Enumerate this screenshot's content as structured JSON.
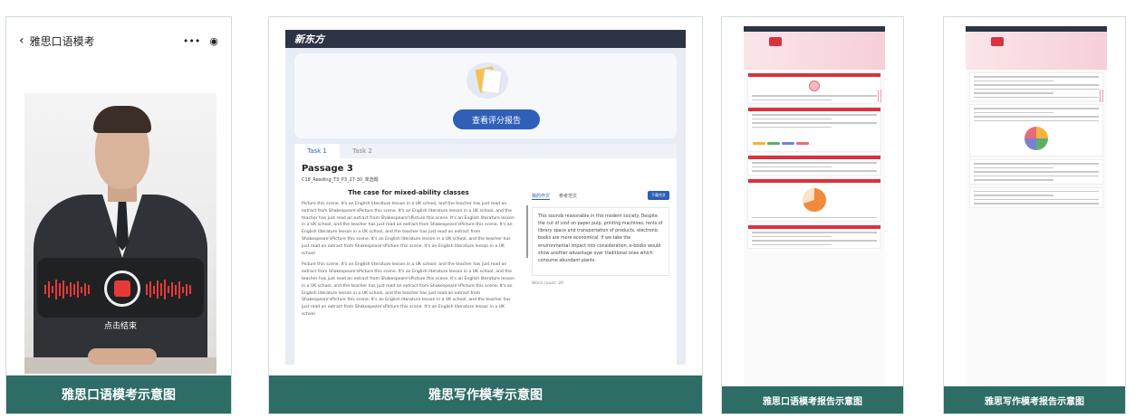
{
  "speaking_mock": {
    "nav_title": "雅思口语模考",
    "back_icon": "chevron-left-icon",
    "more_glyph": "•••",
    "record_label": "点击结束",
    "caption": "雅思口语模考示意图"
  },
  "writing_mock": {
    "logo": "新东方",
    "report_button": "查看评分报告",
    "tabs": [
      "Task 1",
      "Task 2"
    ],
    "active_tab": "Task 1",
    "passage_title": "Passage 3",
    "passage_subtitle": "C18_Reading_T3_P3_27-30_单选题",
    "article_title": "The case for mixed-ability classes",
    "paragraph_1": "Picture this scene. It's an English literature lesson in a UK school, and the teacher has just read an extract from Shakespeare'sPicture this scene. It's an English literature lesson in a UK school, and the teacher has just read an extract from Shakespeare'sPicture this scene. It's an English literature lesson in a UK school, and the teacher has just read an extract from Shakespeare'sPicture this scene. It's an English literature lesson in a UK school, and the teacher has just read an extract from Shakespeare'sPicture this scene. It's an English literature lesson in a UK school, and the teacher has just read an extract from Shakespeare'sPicture this scene. It's an English literature lesson in a UK school",
    "paragraph_2": "Picture this scene. It's an English literature lesson in a UK school, and the teacher has just read an extract from Shakespeare'sPicture this scene. It's an English literature lesson in a UK school, and the teacher has just read an extract from Shakespeare'sPicture this scene. It's an English literature lesson in a UK school, and the teacher has just read an extract from Shakespeare'sPicture this scene. It's an English literature lesson in a UK school, and the teacher has just read an extract from Shakespeare'sPicture this scene. It's an English literature lesson in a UK school, and the teacher has just read an extract from Shakespeare'sPicture this scene. It's an English literature lesson in a UK school",
    "answer_tabs": [
      "我的作文",
      "参考范文"
    ],
    "download_button": "下载作文",
    "essay_text": "This sounds reasonable in this modern society. Despite the cut of cost on paper pulp, printing machines, rents of library space and transportation of products, electronic books are more economical. If we take the environmental impact into consideration, e-books would show another advantage over traditional ones which consume abundant plants.",
    "word_count": "Word count: 20",
    "caption": "雅思写作模考示意图"
  },
  "speaking_report": {
    "caption": "雅思口语模考报告示意图"
  },
  "writing_report": {
    "caption": "雅思写作模考报告示意图"
  },
  "colors": {
    "caption_bg": "#2e6c66",
    "brand_blue": "#2f5fb7",
    "report_red": "#d9323f"
  }
}
